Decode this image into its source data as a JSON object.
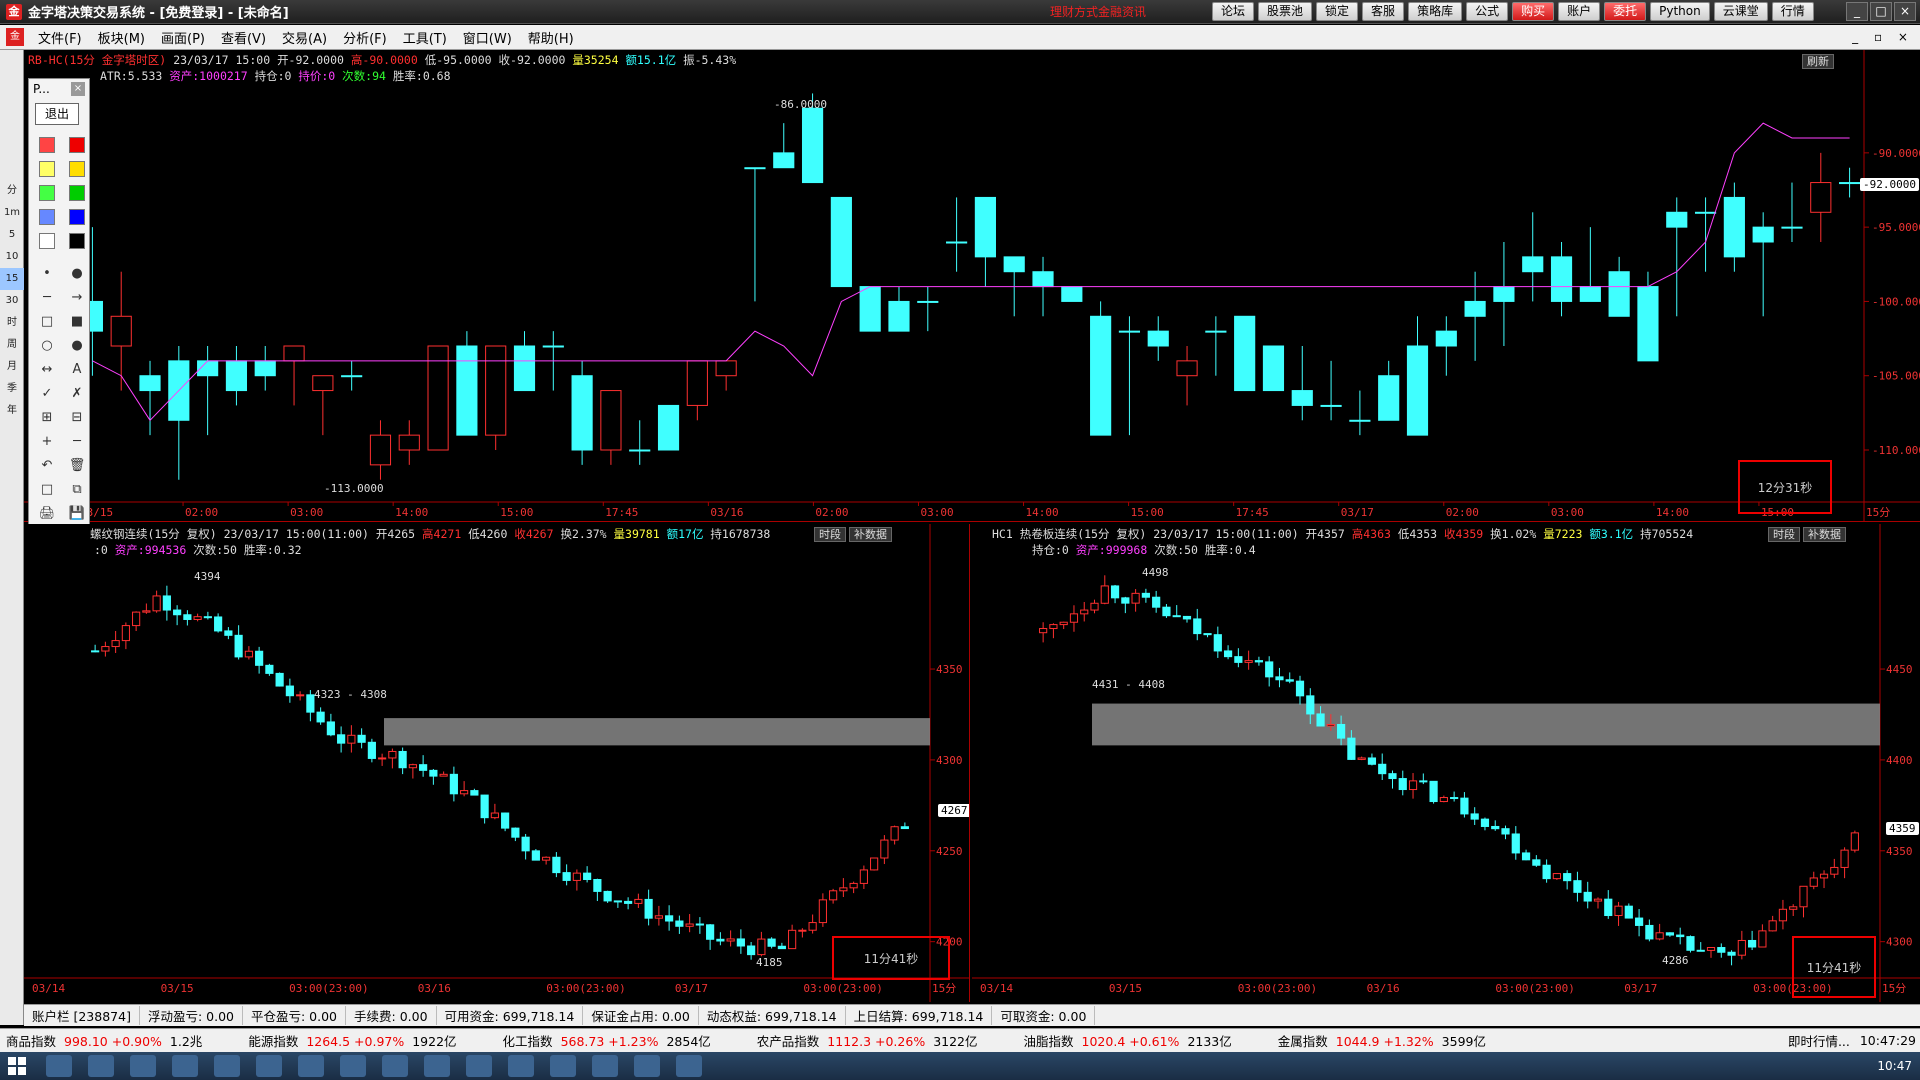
{
  "window": {
    "title": "金字塔决策交易系统 - [免费登录] - [未命名]",
    "notice": "理财方式金融资讯",
    "top_buttons": [
      "论坛",
      "股票池",
      "锁定",
      "客服",
      "策略库",
      "公式",
      "购买",
      "账户",
      "委托",
      "Python",
      "云课堂",
      "行情"
    ],
    "red_buttons": [
      "购买",
      "委托"
    ],
    "controls": [
      "_",
      "□",
      "×"
    ]
  },
  "menu": {
    "items": [
      "文件(F)",
      "板块(M)",
      "画面(P)",
      "查看(V)",
      "交易(A)",
      "分析(F)",
      "工具(T)",
      "窗口(W)",
      "帮助(H)"
    ],
    "right_controls": "_ ▫ ×"
  },
  "left_tools": [
    "分",
    "1m",
    "5",
    "10",
    "15",
    "30",
    "时",
    "周",
    "月",
    "季",
    "年"
  ],
  "draw_panel": {
    "title": "P...",
    "close": "×",
    "exit_label": "退出",
    "tools": [
      "•",
      "●",
      "─",
      "→",
      "□",
      "■",
      "○",
      "●",
      "↔",
      "A",
      "✓",
      "✗",
      "⊞",
      "⊟",
      "+",
      "─",
      "↶",
      "🗑",
      "□",
      "⧉",
      "🖨",
      "💾",
      "▣",
      "ℹ"
    ],
    "colors": [
      "#ff4444",
      "#ee0000",
      "#ffff66",
      "#ffdd00",
      "#44ff44",
      "#00cc00",
      "#6688ff",
      "#0000ff",
      "#ffffff",
      "#000000"
    ]
  },
  "top_chart": {
    "info": {
      "symbol": "RB-HC(15分 金字塔时区)",
      "datetime": "23/03/17 15:00",
      "open": "开-92.0000",
      "high": "高-90.0000",
      "low": "低-95.0000",
      "close": "收-92.0000",
      "volume": "量35254",
      "amount": "额15.1亿",
      "amplitude": "振-5.43%"
    },
    "info2": {
      "atr": "ATR:5.533",
      "asset": "资产:1000217",
      "position": "持仓:0",
      "hold_price": "持价:0",
      "count": "次数:94",
      "win_rate": "胜率:0.68"
    },
    "refresh_label": "刷新",
    "annotations": [
      "-86.0000",
      "-113.0000"
    ],
    "current_price": "-92.0000",
    "timer": "12分31秒",
    "chart_data": {
      "type": "candlestick",
      "y_ticks": [
        "-90.0000",
        "-95.0000",
        "-100.0000",
        "-105.0000",
        "-110.0000"
      ],
      "ylim": [
        -113.5,
        -85.5
      ],
      "x_ticks": [
        "03/15",
        "02:00",
        "03:00",
        "14:00",
        "15:00",
        "17:45",
        "03/16",
        "02:00",
        "03:00",
        "14:00",
        "15:00",
        "17:45",
        "03/17",
        "02:00",
        "03:00",
        "14:00",
        "15:00",
        "15分"
      ],
      "candles": [
        [
          -100,
          -105,
          -95,
          -102
        ],
        [
          -103,
          -106,
          -98,
          -101
        ],
        [
          -105,
          -109,
          -104,
          -106
        ],
        [
          -104,
          -112,
          -103,
          -108
        ],
        [
          -104,
          -109,
          -103,
          -105
        ],
        [
          -104,
          -107,
          -103,
          -106
        ],
        [
          -104,
          -106,
          -103,
          -105
        ],
        [
          -104,
          -107,
          -103,
          -103
        ],
        [
          -106,
          -109,
          -105,
          -105
        ],
        [
          -105,
          -106,
          -104,
          -105
        ],
        [
          -111,
          -112,
          -108,
          -109
        ],
        [
          -110,
          -111,
          -108,
          -109
        ],
        [
          -110,
          -110,
          -103,
          -103
        ],
        [
          -103,
          -109,
          -102,
          -109
        ],
        [
          -109,
          -110,
          -103,
          -103
        ],
        [
          -103,
          -106,
          -102,
          -106
        ],
        [
          -103,
          -106,
          -102,
          -103
        ],
        [
          -105,
          -111,
          -104,
          -110
        ],
        [
          -110,
          -111,
          -106,
          -106
        ],
        [
          -110,
          -111,
          -108,
          -110
        ],
        [
          -107,
          -110,
          -107,
          -110
        ],
        [
          -107,
          -108,
          -104,
          -104
        ],
        [
          -105,
          -106,
          -104,
          -104
        ],
        [
          -91,
          -100,
          -91,
          -91
        ],
        [
          -90,
          -91,
          -88,
          -91
        ],
        [
          -87,
          -92,
          -86,
          -92
        ],
        [
          -93,
          -99,
          -93,
          -99
        ],
        [
          -99,
          -102,
          -99,
          -102
        ],
        [
          -100,
          -102,
          -99,
          -102
        ],
        [
          -100,
          -102,
          -99,
          -100
        ],
        [
          -96,
          -98,
          -93,
          -96
        ],
        [
          -93,
          -99,
          -93,
          -97
        ],
        [
          -97,
          -101,
          -97,
          -98
        ],
        [
          -98,
          -101,
          -97,
          -99
        ],
        [
          -99,
          -100,
          -99,
          -100
        ],
        [
          -101,
          -109,
          -100,
          -109
        ],
        [
          -102,
          -109,
          -101,
          -102
        ],
        [
          -102,
          -104,
          -101,
          -103
        ],
        [
          -105,
          -107,
          -103,
          -104
        ],
        [
          -102,
          -105,
          -101,
          -102
        ],
        [
          -101,
          -106,
          -101,
          -106
        ],
        [
          -103,
          -106,
          -103,
          -106
        ],
        [
          -106,
          -108,
          -103,
          -107
        ],
        [
          -107,
          -108,
          -104,
          -107
        ],
        [
          -108,
          -109,
          -106,
          -108
        ],
        [
          -105,
          -108,
          -104,
          -108
        ],
        [
          -103,
          -109,
          -101,
          -109
        ],
        [
          -102,
          -105,
          -101,
          -103
        ],
        [
          -100,
          -104,
          -98,
          -101
        ],
        [
          -99,
          -103,
          -96,
          -100
        ],
        [
          -97,
          -100,
          -94,
          -98
        ],
        [
          -97,
          -101,
          -96,
          -100
        ],
        [
          -99,
          -100,
          -95,
          -100
        ],
        [
          -98,
          -101,
          -97,
          -101
        ],
        [
          -99,
          -104,
          -98,
          -104
        ],
        [
          -94,
          -101,
          -93,
          -95
        ],
        [
          -94,
          -98,
          -93,
          -94
        ],
        [
          -93,
          -98,
          -92,
          -97
        ],
        [
          -95,
          -101,
          -94,
          -96
        ],
        [
          -95,
          -96,
          -92,
          -95
        ],
        [
          -94,
          -96,
          -90,
          -92
        ],
        [
          -92,
          -93,
          -91,
          -92
        ]
      ],
      "line": [
        -104,
        -105,
        -108,
        -106,
        -104,
        -104,
        -104,
        -104,
        -104,
        -104,
        -104,
        -104,
        -104,
        -104,
        -104,
        -104,
        -104,
        -104,
        -104,
        -104,
        -104,
        -104,
        -104,
        -102,
        -103,
        -105,
        -100,
        -99,
        -99,
        -99,
        -99,
        -99,
        -99,
        -99,
        -99,
        -99,
        -99,
        -99,
        -99,
        -99,
        -99,
        -99,
        -99,
        -99,
        -99,
        -99,
        -99,
        -99,
        -99,
        -99,
        -99,
        -99,
        -99,
        -99,
        -99,
        -98,
        -96,
        -90,
        -88,
        -89,
        -89,
        -89
      ]
    }
  },
  "bottom_left_chart": {
    "info": {
      "symbol": "螺纹钢连续(15分 复权)",
      "datetime": "23/03/17 15:00(11:00)",
      "open": "开4265",
      "high": "高4271",
      "low": "低4260",
      "close": "收4267",
      "change": "换2.37%",
      "volume": "量39781",
      "amount": "额17亿",
      "hold": "持1678738"
    },
    "info2": {
      "position": ":0",
      "asset": "资产:994536",
      "count": "次数:50",
      "win_rate": "胜率:0.32"
    },
    "buttons": [
      "时段",
      "补数据"
    ],
    "annotations": [
      "4394",
      "4323 - 4308",
      "4185"
    ],
    "current_price": "4267",
    "timer": "11分41秒",
    "chart_data": {
      "type": "candlestick",
      "y_ticks": [
        "4350",
        "4300",
        "4250",
        "4200"
      ],
      "ylim": [
        4180,
        4410
      ],
      "x_ticks": [
        "03/14",
        "03/15",
        "03:00(23:00)",
        "03/16",
        "03:00(23:00)",
        "03/17",
        "03:00(23:00)",
        "15分"
      ]
    }
  },
  "bottom_right_chart": {
    "info": {
      "symbol": "HC1 热卷板连续(15分 复权)",
      "datetime": "23/03/17 15:00(11:00)",
      "open": "开4357",
      "high": "高4363",
      "low": "低4353",
      "close": "收4359",
      "change": "换1.02%",
      "volume": "量7223",
      "amount": "额3.1亿",
      "hold": "持705524"
    },
    "info2": {
      "position": "持仓:0",
      "asset": "资产:999968",
      "count": "次数:50",
      "win_rate": "胜率:0.4"
    },
    "buttons": [
      "时段",
      "补数据"
    ],
    "annotations": [
      "4498",
      "4431 - 4408",
      "4286"
    ],
    "current_price": "4359",
    "timer": "11分41秒",
    "chart_data": {
      "type": "candlestick",
      "y_ticks": [
        "4450",
        "4400",
        "4350",
        "4300"
      ],
      "ylim": [
        4280,
        4510
      ],
      "x_ticks": [
        "03/14",
        "03/15",
        "03:00(23:00)",
        "03/16",
        "03:00(23:00)",
        "03/17",
        "03:00(23:00)",
        "15分"
      ]
    }
  },
  "status": {
    "items": [
      "账户栏 [238874]",
      "浮动盈亏: 0.00",
      "平仓盈亏: 0.00",
      "手续费: 0.00",
      "可用资金: 699,718.14",
      "保证金占用: 0.00",
      "动态权益: 699,718.14",
      "上日结算: 699,718.14",
      "可取资金: 0.00"
    ]
  },
  "indices": [
    {
      "name": "商品指数",
      "value": "998.10 +0.90%",
      "extra": "1.2兆"
    },
    {
      "name": "能源指数",
      "value": "1264.5 +0.97%",
      "extra": "1922亿"
    },
    {
      "name": "化工指数",
      "value": "568.73 +1.23%",
      "extra": "2854亿"
    },
    {
      "name": "农产品指数",
      "value": "1112.3 +0.26%",
      "extra": "3122亿"
    },
    {
      "name": "油脂指数",
      "value": "1020.4 +0.61%",
      "extra": "2133亿"
    },
    {
      "name": "金属指数",
      "value": "1044.9 +1.32%",
      "extra": "3599亿"
    }
  ],
  "index_right": {
    "label": "即时行情...",
    "time": "10:47:29"
  },
  "taskbar": {
    "clock": "10:47"
  }
}
